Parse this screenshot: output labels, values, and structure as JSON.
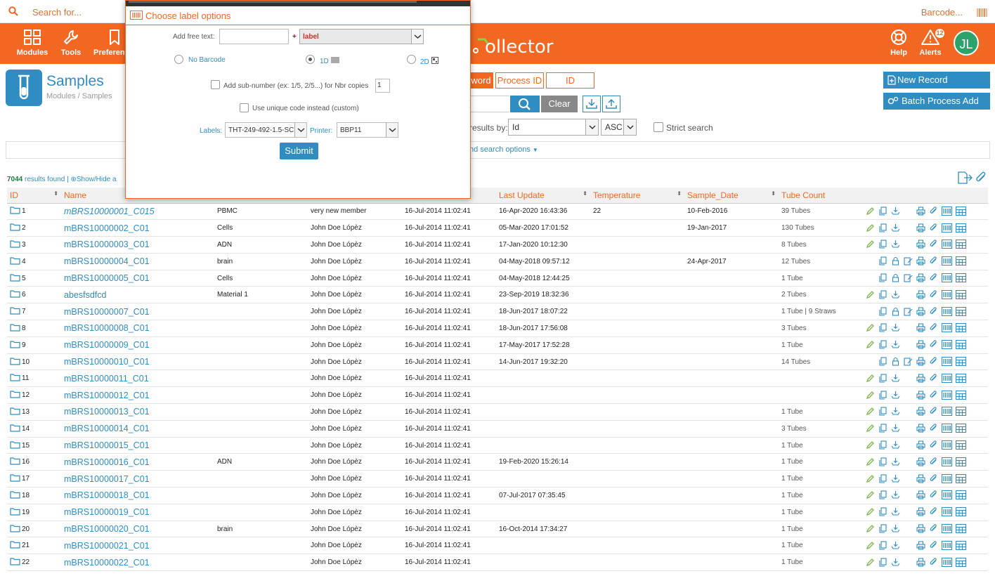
{
  "topbar": {
    "search_placeholder": "Search for...",
    "barcode_label": "Barcode..."
  },
  "nav": {
    "modules": "Modules",
    "tools": "Tools",
    "preferences": "Preferen",
    "brand": "ollector",
    "help": "Help",
    "alerts": "Alerts",
    "alerts_count": "12",
    "avatar_initials": "JL"
  },
  "page": {
    "title": "Samples",
    "breadcrumb": "Modules / Samples"
  },
  "tabs": [
    "word",
    "Process ID",
    "ID"
  ],
  "search": {
    "clear": "Clear"
  },
  "sort": {
    "label": "results by:",
    "field": "Id",
    "order": "ASC",
    "strict": "Strict search"
  },
  "advanced": "nd search options",
  "buttons": {
    "new_record": "New Record",
    "batch": "Batch Process Add"
  },
  "results": {
    "count": "7044",
    "suffix": "results found |",
    "show_hide": "Show/Hide a"
  },
  "columns": [
    "ID",
    "Name",
    "",
    "",
    "",
    "Last Update",
    "Temperature",
    "Sample_Date",
    "Tube Count"
  ],
  "rows": [
    {
      "id": "1",
      "name": "mBRS10000001_C015",
      "type": "PBMC",
      "member": "very new member",
      "created": "16-Jul-2014 11:02:41",
      "updated": "16-Apr-2020 16:43:36",
      "temp": "22",
      "sdate": "10-Feb-2016",
      "tubes": "39 Tubes",
      "mode": "a"
    },
    {
      "id": "2",
      "name": "mBRS10000002_C01",
      "type": "Cells",
      "member": "John Doe Lópèz",
      "created": "16-Jul-2014 11:02:41",
      "updated": "05-Mar-2020 17:01:52",
      "temp": "",
      "sdate": "19-Jan-2017",
      "tubes": "130 Tubes",
      "mode": "a"
    },
    {
      "id": "3",
      "name": "mBRS10000003_C01",
      "type": "ADN",
      "member": "John Doe Lópèz",
      "created": "16-Jul-2014 11:02:41",
      "updated": "17-Jan-2020 10:12:30",
      "temp": "",
      "sdate": "",
      "tubes": "8 Tubes",
      "mode": "a"
    },
    {
      "id": "4",
      "name": "mBRS10000004_C01",
      "type": "brain",
      "member": "John Doe Lópèz",
      "created": "16-Jul-2014 11:02:41",
      "updated": "04-May-2018 09:57:12",
      "temp": "",
      "sdate": "24-Apr-2017",
      "tubes": "12 Tubes",
      "mode": "b"
    },
    {
      "id": "5",
      "name": "mBRS10000005_C01",
      "type": "Cells",
      "member": "John Doe Lópèz",
      "created": "16-Jul-2014 11:02:41",
      "updated": "04-May-2018 12:44:25",
      "temp": "",
      "sdate": "",
      "tubes": "1 Tube",
      "mode": "b"
    },
    {
      "id": "6",
      "name": "abesfsdfcd",
      "type": "Material 1",
      "member": "John Doe Lópèz",
      "created": "16-Jul-2014 11:02:41",
      "updated": "23-Sep-2019 18:32:36",
      "temp": "",
      "sdate": "",
      "tubes": "2 Tubes",
      "mode": "a"
    },
    {
      "id": "7",
      "name": "mBRS10000007_C01",
      "type": "",
      "member": "John Doe Lópèz",
      "created": "16-Jul-2014 11:02:41",
      "updated": "18-Jun-2017 18:07:22",
      "temp": "",
      "sdate": "",
      "tubes": "1 Tube | 9 Straws",
      "mode": "b"
    },
    {
      "id": "8",
      "name": "mBRS10000008_C01",
      "type": "",
      "member": "John Doe Lópèz",
      "created": "16-Jul-2014 11:02:41",
      "updated": "18-Jun-2017 17:56:08",
      "temp": "",
      "sdate": "",
      "tubes": "3 Tubes",
      "mode": "a"
    },
    {
      "id": "9",
      "name": "mBRS10000009_C01",
      "type": "",
      "member": "John Doe Lópèz",
      "created": "16-Jul-2014 11:02:41",
      "updated": "17-May-2017 17:52:28",
      "temp": "",
      "sdate": "",
      "tubes": "1 Tube",
      "mode": "a"
    },
    {
      "id": "10",
      "name": "mBRS10000010_C01",
      "type": "",
      "member": "John Doe Lópèz",
      "created": "16-Jul-2014 11:02:41",
      "updated": "14-Jun-2017 19:32:20",
      "temp": "",
      "sdate": "",
      "tubes": "14 Tubes",
      "mode": "b"
    },
    {
      "id": "11",
      "name": "mBRS10000011_C01",
      "type": "",
      "member": "John Doe Lópèz",
      "created": "16-Jul-2014 11:02:41",
      "updated": "",
      "temp": "",
      "sdate": "",
      "tubes": "",
      "mode": "a"
    },
    {
      "id": "12",
      "name": "mBRS10000012_C01",
      "type": "",
      "member": "John Doe Lópèz",
      "created": "16-Jul-2014 11:02:41",
      "updated": "",
      "temp": "",
      "sdate": "",
      "tubes": "",
      "mode": "a"
    },
    {
      "id": "13",
      "name": "mBRS10000013_C01",
      "type": "",
      "member": "John Doe Lópèz",
      "created": "16-Jul-2014 11:02:41",
      "updated": "",
      "temp": "",
      "sdate": "",
      "tubes": "1 Tube",
      "mode": "a"
    },
    {
      "id": "14",
      "name": "mBRS10000014_C01",
      "type": "",
      "member": "John Doe Lópèz",
      "created": "16-Jul-2014 11:02:41",
      "updated": "",
      "temp": "",
      "sdate": "",
      "tubes": "3 Tubes",
      "mode": "a"
    },
    {
      "id": "15",
      "name": "mBRS10000015_C01",
      "type": "",
      "member": "John Doe Lópèz",
      "created": "16-Jul-2014 11:02:41",
      "updated": "",
      "temp": "",
      "sdate": "",
      "tubes": "1 Tube",
      "mode": "a"
    },
    {
      "id": "16",
      "name": "mBRS10000016_C01",
      "type": "ADN",
      "member": "John Doe Lópèz",
      "created": "16-Jul-2014 11:02:41",
      "updated": "19-Feb-2020 15:26:14",
      "temp": "",
      "sdate": "",
      "tubes": "1 Tube",
      "mode": "a"
    },
    {
      "id": "17",
      "name": "mBRS10000017_C01",
      "type": "",
      "member": "John Doe Lópèz",
      "created": "16-Jul-2014 11:02:41",
      "updated": "",
      "temp": "",
      "sdate": "",
      "tubes": "1 Tube",
      "mode": "a"
    },
    {
      "id": "18",
      "name": "mBRS10000018_C01",
      "type": "",
      "member": "John Doe Lópèz",
      "created": "16-Jul-2014 11:02:41",
      "updated": "07-Jul-2017 07:35:45",
      "temp": "",
      "sdate": "",
      "tubes": "1 Tube",
      "mode": "a"
    },
    {
      "id": "19",
      "name": "mBRS10000019_C01",
      "type": "",
      "member": "John Doe Lópèz",
      "created": "16-Jul-2014 11:02:41",
      "updated": "",
      "temp": "",
      "sdate": "",
      "tubes": "1 Tube",
      "mode": "a"
    },
    {
      "id": "20",
      "name": "mBRS10000020_C01",
      "type": "brain",
      "member": "John Doe Lópèz",
      "created": "16-Jul-2014 11:02:41",
      "updated": "16-Oct-2014 17:34:27",
      "temp": "",
      "sdate": "",
      "tubes": "1 Tube",
      "mode": "a"
    },
    {
      "id": "21",
      "name": "mBRS10000021_C01",
      "type": "",
      "member": "John Doe Lópèz",
      "created": "16-Jul-2014 11:02:41",
      "updated": "",
      "temp": "",
      "sdate": "",
      "tubes": "1 Tube",
      "mode": "a"
    },
    {
      "id": "22",
      "name": "mBRS10000022_C01",
      "type": "",
      "member": "John Doe Lópèz",
      "created": "16-Jul-2014 11:02:41",
      "updated": "",
      "temp": "",
      "sdate": "",
      "tubes": "1 Tube",
      "mode": "a"
    }
  ],
  "modal": {
    "title": "Choose label options",
    "free_text_label": "Add free text:",
    "plus": "+",
    "label_select": "label",
    "no_barcode": "No Barcode",
    "one_d": "1D",
    "two_d": "2D",
    "sub_number": "Add sub-number (ex: 1/5, 2/5...) for Nbr copies",
    "copies": "1",
    "unique_code": "Use unique code instead (custom)",
    "labels_label": "Labels:",
    "labels_value": "THT-249-492-1.5-SC",
    "printer_label": "Printer:",
    "printer_value": "BBP11",
    "submit": "Submit"
  },
  "colors": {
    "accent": "#f26722",
    "primary": "#2f8dc1",
    "green": "#7ab648"
  }
}
